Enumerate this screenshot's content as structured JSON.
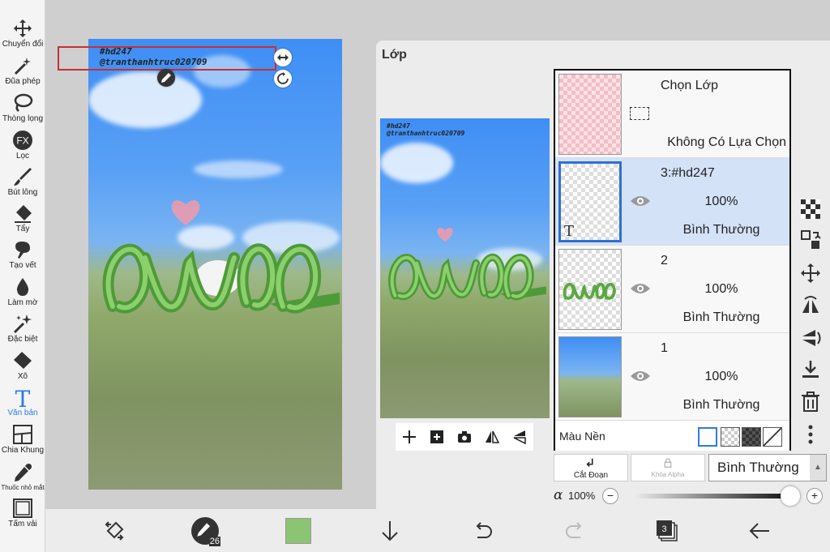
{
  "tools": [
    {
      "id": "move",
      "label": "Chuyển đổi",
      "icon": "move-icon"
    },
    {
      "id": "magic",
      "label": "Đũa phép",
      "icon": "magic-wand-icon"
    },
    {
      "id": "lasso",
      "label": "Thòng lọng",
      "icon": "lasso-icon"
    },
    {
      "id": "filter",
      "label": "Lọc",
      "icon": "fx-icon"
    },
    {
      "id": "brush",
      "label": "Bút lông",
      "icon": "brush-icon"
    },
    {
      "id": "eraser",
      "label": "Tẩy",
      "icon": "eraser-icon"
    },
    {
      "id": "smudge",
      "label": "Tạo vết",
      "icon": "smudge-icon"
    },
    {
      "id": "blur",
      "label": "Làm mờ",
      "icon": "blur-drop-icon"
    },
    {
      "id": "special",
      "label": "Đặc biệt",
      "icon": "sparkle-icon"
    },
    {
      "id": "bucket",
      "label": "Xô",
      "icon": "bucket-icon"
    },
    {
      "id": "text",
      "label": "Văn bản",
      "icon": "text-icon"
    },
    {
      "id": "frame",
      "label": "Chia Khung",
      "icon": "frame-divider-icon"
    },
    {
      "id": "dropper",
      "label": "Thuốc nhỏ mắt",
      "icon": "eyedropper-icon"
    },
    {
      "id": "canvas",
      "label": "Tấm vải",
      "icon": "canvas-icon"
    }
  ],
  "active_tool": "text",
  "canvas": {
    "text_line1": "#hd247",
    "text_line2": "@tranthanhtruc020709",
    "big_word": "owo"
  },
  "panel": {
    "title": "Lớp",
    "selection_layer": {
      "title": "Chọn Lớp",
      "status": "Không Có Lựa Chọn"
    },
    "layers": [
      {
        "name": "3:#hd247",
        "opacity": "100%",
        "blend": "Bình Thường",
        "selected": true,
        "type_mark": "T"
      },
      {
        "name": "2",
        "opacity": "100%",
        "blend": "Bình Thường",
        "selected": false
      },
      {
        "name": "1",
        "opacity": "100%",
        "blend": "Bình Thường",
        "selected": false
      }
    ],
    "bg_color_label": "Màu Nền",
    "clip_label": "Cắt Đoạn",
    "alpha_lock_label": "Khóa Alpha",
    "blend_mode": "Bình Thường",
    "alpha_symbol": "α",
    "alpha_value": "100%",
    "alpha_fraction": 1.0
  },
  "bottom_bar": {
    "brush_size": "26",
    "layer_count": "3",
    "color": "#8cc572"
  },
  "colors": {
    "accent": "#2a7be4",
    "selection_red": "#c43131",
    "selected_layer_bg": "#d4e2f7"
  }
}
